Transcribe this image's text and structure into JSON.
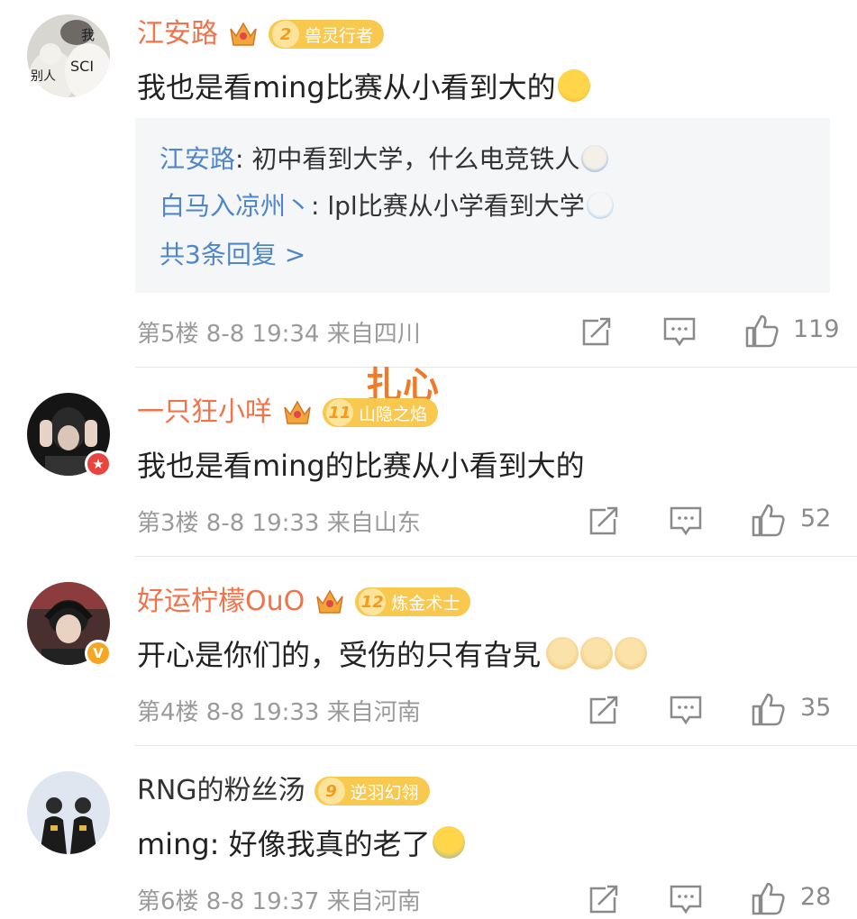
{
  "colors": {
    "name_orange": "#f2734a",
    "reply_blue": "#4f86c9",
    "meta_gray": "#9a9a9a",
    "badge_gold": "#f9c84f"
  },
  "overlay_text": "扎心",
  "comments": [
    {
      "user": "江安路",
      "avatar_text": [
        "我",
        "别人",
        "SCI"
      ],
      "crown_level": "2",
      "fan_level": "2",
      "fan_title": "兽灵行者",
      "text": "我也是看ming比赛从小看到大的",
      "emoji": "cry-laugh-emoji",
      "replies": [
        {
          "name": "江安路",
          "sep": ": ",
          "text": "初中看到大学，什么电竞铁人",
          "emoji": "doge-emoji"
        },
        {
          "name": "白马入凉州丶",
          "sep": ": ",
          "text": "lpl比赛从小学看到大学",
          "emoji": "shocked-emoji"
        }
      ],
      "more_replies": "共3条回复 >",
      "meta": "第5楼 8-8 19:34 来自四川",
      "likes": "119"
    },
    {
      "user": "一只狂小咩",
      "crown_level": "4",
      "fan_level": "11",
      "fan_title": "山隐之焰",
      "text": "我也是看ming的比赛从小看到大的",
      "meta": "第3楼 8-8 19:33 来自山东",
      "likes": "52"
    },
    {
      "user": "好运柠檬OuO",
      "crown_level": "4",
      "fan_level": "12",
      "fan_title": "炼金术士",
      "verified": "V",
      "text": "开心是你们的，受伤的只有旮旯",
      "emoji": "dog-emoji",
      "meta": "第4楼 8-8 19:33 来自河南",
      "likes": "35"
    },
    {
      "user": "RNG的粉丝汤",
      "fan_level": "9",
      "fan_title": "逆羽幻翎",
      "text": "ming: 好像我真的老了",
      "emoji": "crying-emoji",
      "meta": "第6楼 8-8 19:37 来自河南",
      "likes": "28"
    }
  ]
}
